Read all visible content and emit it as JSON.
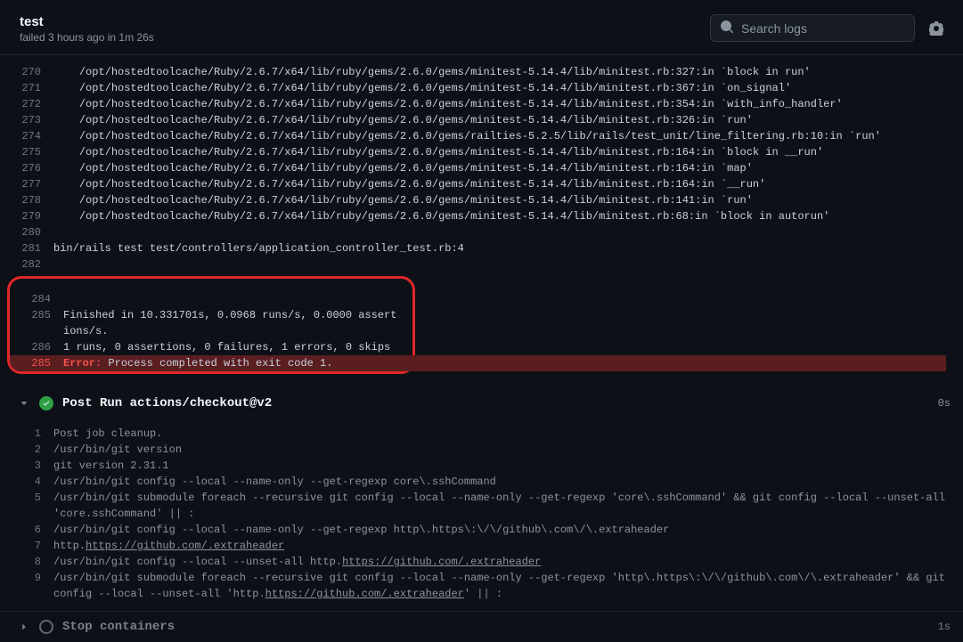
{
  "header": {
    "title": "test",
    "status": "failed 3 hours ago in 1m 26s"
  },
  "search": {
    "placeholder": "Search logs"
  },
  "section1": {
    "lines": [
      {
        "n": 270,
        "t": "    /opt/hostedtoolcache/Ruby/2.6.7/x64/lib/ruby/gems/2.6.0/gems/minitest-5.14.4/lib/minitest.rb:327:in `block in run'"
      },
      {
        "n": 271,
        "t": "    /opt/hostedtoolcache/Ruby/2.6.7/x64/lib/ruby/gems/2.6.0/gems/minitest-5.14.4/lib/minitest.rb:367:in `on_signal'"
      },
      {
        "n": 272,
        "t": "    /opt/hostedtoolcache/Ruby/2.6.7/x64/lib/ruby/gems/2.6.0/gems/minitest-5.14.4/lib/minitest.rb:354:in `with_info_handler'"
      },
      {
        "n": 273,
        "t": "    /opt/hostedtoolcache/Ruby/2.6.7/x64/lib/ruby/gems/2.6.0/gems/minitest-5.14.4/lib/minitest.rb:326:in `run'"
      },
      {
        "n": 274,
        "t": "    /opt/hostedtoolcache/Ruby/2.6.7/x64/lib/ruby/gems/2.6.0/gems/railties-5.2.5/lib/rails/test_unit/line_filtering.rb:10:in `run'"
      },
      {
        "n": 275,
        "t": "    /opt/hostedtoolcache/Ruby/2.6.7/x64/lib/ruby/gems/2.6.0/gems/minitest-5.14.4/lib/minitest.rb:164:in `block in __run'"
      },
      {
        "n": 276,
        "t": "    /opt/hostedtoolcache/Ruby/2.6.7/x64/lib/ruby/gems/2.6.0/gems/minitest-5.14.4/lib/minitest.rb:164:in `map'"
      },
      {
        "n": 277,
        "t": "    /opt/hostedtoolcache/Ruby/2.6.7/x64/lib/ruby/gems/2.6.0/gems/minitest-5.14.4/lib/minitest.rb:164:in `__run'"
      },
      {
        "n": 278,
        "t": "    /opt/hostedtoolcache/Ruby/2.6.7/x64/lib/ruby/gems/2.6.0/gems/minitest-5.14.4/lib/minitest.rb:141:in `run'"
      },
      {
        "n": 279,
        "t": "    /opt/hostedtoolcache/Ruby/2.6.7/x64/lib/ruby/gems/2.6.0/gems/minitest-5.14.4/lib/minitest.rb:68:in `block in autorun'"
      },
      {
        "n": 280,
        "t": ""
      },
      {
        "n": 281,
        "t": "bin/rails test test/controllers/application_controller_test.rb:4"
      },
      {
        "n": 282,
        "t": ""
      }
    ],
    "boxed": [
      {
        "n": 284,
        "t": ""
      },
      {
        "n": 285,
        "t": "Finished in 10.331701s, 0.0968 runs/s, 0.0000 assertions/s."
      },
      {
        "n": 286,
        "t": "1 runs, 0 assertions, 0 failures, 1 errors, 0 skips"
      }
    ],
    "error_line": {
      "n": 285,
      "prefix": "Error:",
      "rest": " Process completed with exit code 1."
    }
  },
  "step1": {
    "title": "Post Run actions/checkout@v2",
    "time": "0s"
  },
  "section2": {
    "lines": [
      {
        "n": 1,
        "parts": [
          {
            "t": "Post job cleanup."
          }
        ]
      },
      {
        "n": 2,
        "parts": [
          {
            "t": "/usr/bin/git version"
          }
        ]
      },
      {
        "n": 3,
        "parts": [
          {
            "t": "git version 2.31.1"
          }
        ]
      },
      {
        "n": 4,
        "parts": [
          {
            "t": "/usr/bin/git config --local --name-only --get-regexp core\\.sshCommand"
          }
        ]
      },
      {
        "n": 5,
        "parts": [
          {
            "t": "/usr/bin/git submodule foreach --recursive git config --local --name-only --get-regexp 'core\\.sshCommand' && git config --local --unset-all 'core.sshCommand' || :"
          }
        ]
      },
      {
        "n": 6,
        "parts": [
          {
            "t": "/usr/bin/git config --local --name-only --get-regexp http\\.https\\:\\/\\/github\\.com\\/\\.extraheader"
          }
        ]
      },
      {
        "n": 7,
        "parts": [
          {
            "t": "http."
          },
          {
            "t": "https://github.com/.extraheader",
            "link": true
          }
        ]
      },
      {
        "n": 8,
        "parts": [
          {
            "t": "/usr/bin/git config --local --unset-all http."
          },
          {
            "t": "https://github.com/.extraheader",
            "link": true
          }
        ]
      },
      {
        "n": 9,
        "parts": [
          {
            "t": "/usr/bin/git submodule foreach --recursive git config --local --name-only --get-regexp 'http\\.https\\:\\/\\/github\\.com\\/\\.extraheader' && git config --local --unset-all 'http."
          },
          {
            "t": "https://github.com/.extraheader",
            "link": true
          },
          {
            "t": "' || :"
          }
        ]
      }
    ]
  },
  "step2": {
    "title": "Stop containers",
    "time": "1s"
  }
}
